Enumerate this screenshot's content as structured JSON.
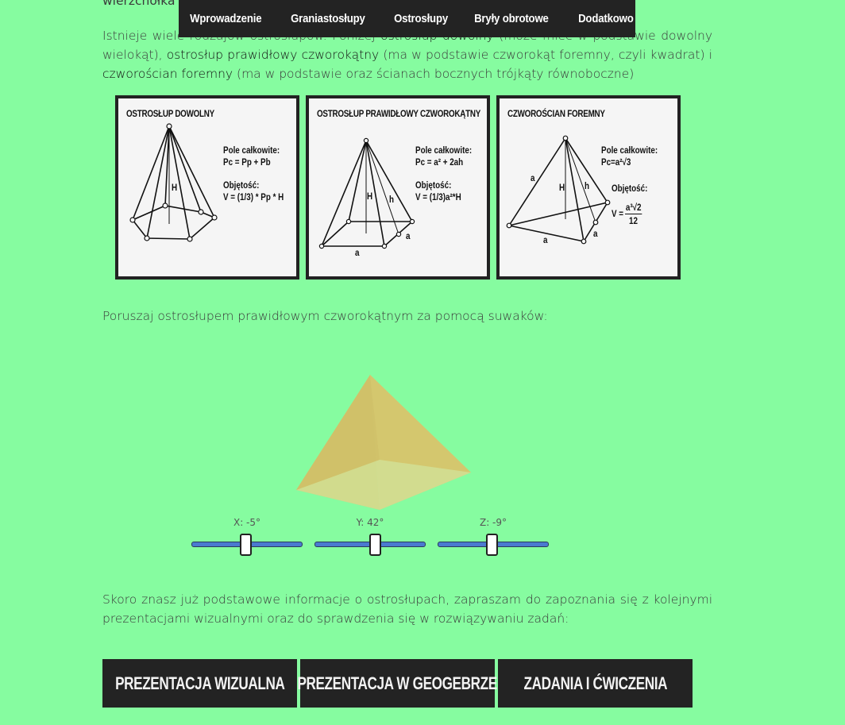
{
  "top_cut_text": "wierzchołka od",
  "nav": {
    "items": [
      "Wprowadzenie",
      "Graniastosłupy",
      "Ostrosłupy",
      "Bryły obrotowe",
      "Dodatkowo"
    ]
  },
  "intro": {
    "part1": "Istnieje wiele rodzajów ostrosłupów. Poniżej ",
    "term1": "ostrosłup dowolny",
    "part2": " (może mieć w podstawie dowolny wielokąt), ",
    "term2": "ostrosłup prawidłowy czworokątny",
    "part3": " (ma w podstawie czworokąt foremny, czyli kwadrat) i ",
    "term3": "czworościan foremny",
    "part4": " (ma w podstawie oraz ścianach bocznych trójkąty równoboczne)"
  },
  "cards": [
    {
      "title": "OSTROSŁUP DOWOLNY",
      "f1": "Pole całkowite:",
      "f2": "Pc = Pp + Pb",
      "f3": "Objętość:",
      "f4": "V = (1/3) * Pp * H",
      "h": "H"
    },
    {
      "title": "OSTROSŁUP PRAWIDŁOWY CZWOROKĄTNY",
      "f1": "Pole całkowite:",
      "f2": "Pc = a² + 2ah",
      "f3": "Objętość:",
      "f4": "V = (1/3)a²*H",
      "h": "H",
      "h2": "h",
      "a": "a"
    },
    {
      "title": "CZWOROŚCIAN FOREMNY",
      "f1": "Pole całkowite:",
      "f2": "Pc=a²√3",
      "f3": "Objętość:",
      "f4": "V =",
      "num": "a³√2",
      "den": "12",
      "h": "H",
      "h2": "h",
      "a": "a"
    }
  ],
  "slider_intro": "Poruszaj ostrosłupem prawidłowym czworokątnym za pomocą suwaków:",
  "sliders": [
    {
      "label": "X: -5°",
      "value": -5
    },
    {
      "label": "Y: 42°",
      "value": 42
    },
    {
      "label": "Z: -9°",
      "value": -9
    }
  ],
  "outro": "Skoro znasz już podstawowe informacje o ostrosłupach, zapraszam do zapoznania się z kolejnymi prezentacjami wizualnymi oraz do sprawdzenia się w rozwiązywaniu zadań:",
  "buttons": [
    "PREZENTACJA WIZUALNA",
    "PREZENTACJA W GEOGEBRZE",
    "ZADANIA I ĆWICZENIA"
  ],
  "colors": {
    "background": "#86fca0",
    "nav_bg": "#232323",
    "slider_track": "#4a7ad0",
    "pyramid": "#d8cc78"
  }
}
